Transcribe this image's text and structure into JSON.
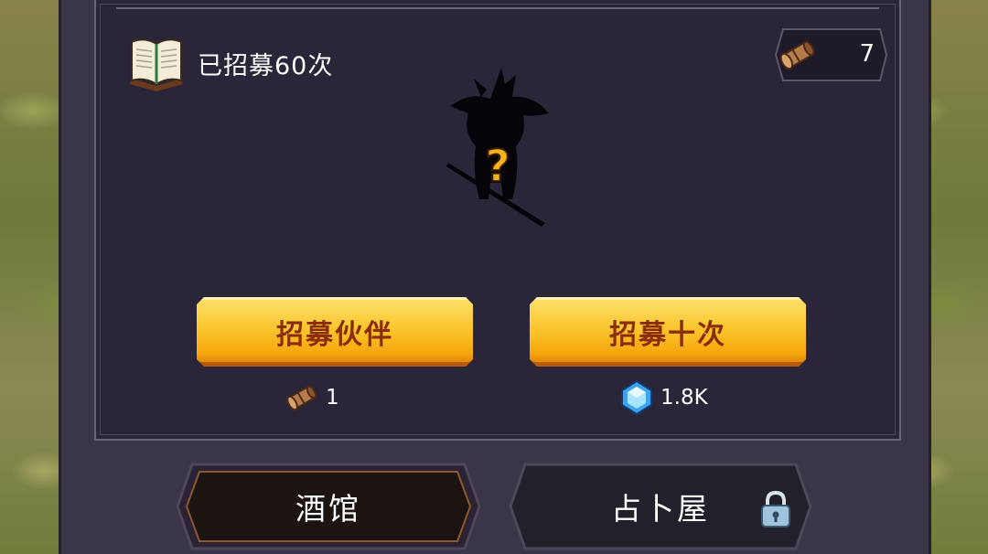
{
  "header": {
    "recruit_count_text": "已招募60次",
    "ticket_count": "7"
  },
  "actions": {
    "recruit_one_label": "招募伙伴",
    "recruit_ten_label": "招募十次",
    "recruit_one_cost": "1",
    "recruit_ten_cost": "1.8K"
  },
  "tabs": [
    {
      "label": "酒馆",
      "selected": true,
      "locked": false
    },
    {
      "label": "占卜屋",
      "selected": false,
      "locked": true
    }
  ],
  "icons": {
    "book": "book-icon",
    "ticket": "recruit-ticket-icon",
    "gem": "diamond-gem-icon",
    "lock": "lock-icon",
    "mystery": "mystery-hero-silhouette"
  },
  "colors": {
    "button_gold": "#fcc62e",
    "button_text": "#8b2d0a",
    "panel_dark": "#2a2538",
    "question_mark": "#f6b31a"
  }
}
